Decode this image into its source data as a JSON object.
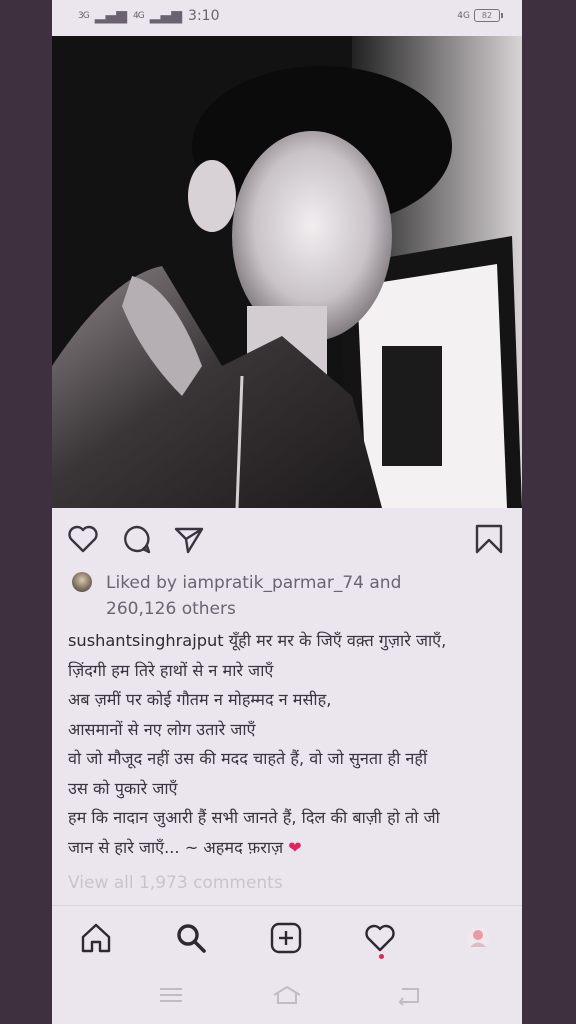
{
  "status_bar": {
    "signal_1": "3G",
    "signal_2": "4G",
    "time": "3:10",
    "network": "4G",
    "battery": "82"
  },
  "post": {
    "photo_icon": "post-photo",
    "liked_prefix": "Liked by ",
    "liked_user": "iampratik_parmar_74",
    "liked_and": " and",
    "liked_count": "260,126 others",
    "caption_user": "sushantsinghrajput",
    "caption_lines": [
      "यूँही मर मर के जिएँ वक़्त गुज़ारे जाएँ,",
      "ज़िंदगी हम तिरे हाथों से न मारे जाएँ",
      "अब ज़मीं पर कोई गौतम न मोहम्मद न मसीह,",
      "आसमानों से नए लोग उतारे जाएँ",
      "वो जो मौजूद नहीं उस की मदद चाहते हैं, वो जो सुनता ही नहीं",
      "उस को पुकारे जाएँ",
      "हम कि नादान जुआरी हैं सभी जानते हैं, दिल की बाज़ी हो तो जी",
      "जान से हारे जाएँ... ~ अहमद फ़राज़"
    ],
    "caption_emoji": "❤",
    "view_comments": "View all 1,973 comments"
  },
  "icons": {
    "like": "heart-icon",
    "comment": "comment-icon",
    "share": "send-icon",
    "save": "bookmark-icon",
    "home": "home-icon",
    "search": "search-icon",
    "add": "add-post-icon",
    "activity": "heart-icon",
    "profile": "profile-avatar",
    "menu": "menu-icon",
    "sys_home": "home-outline-icon",
    "back": "back-icon"
  },
  "colors": {
    "background": "#ebe6ee",
    "frame": "#3f3040",
    "text": "#3b3440",
    "muted": "#6c6272",
    "accent": "#e0245e"
  }
}
